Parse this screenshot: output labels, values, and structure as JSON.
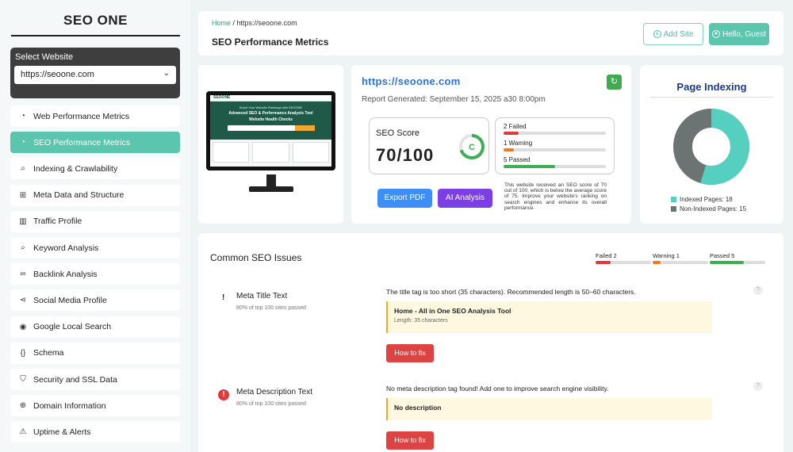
{
  "sidebar": {
    "brand": "SEO ONE",
    "select_label": "Select Website",
    "select_value": "https://seoone.com",
    "items": [
      {
        "label": "Web Performance Metrics",
        "icon": "gauge-icon",
        "glyph": "◔"
      },
      {
        "label": "SEO Performance Metrics",
        "icon": "gauge-icon",
        "glyph": "◔",
        "active": true
      },
      {
        "label": "Indexing & Crawlability",
        "icon": "search-icon",
        "glyph": "⌕"
      },
      {
        "label": "Meta Data and Structure",
        "icon": "sitemap-icon",
        "glyph": "⊞"
      },
      {
        "label": "Traffic Profile",
        "icon": "bar-chart-icon",
        "glyph": "▥"
      },
      {
        "label": "Keyword Analysis",
        "icon": "magnifier-icon",
        "glyph": "⌕"
      },
      {
        "label": "Backlink Analysis",
        "icon": "link-icon",
        "glyph": "∞"
      },
      {
        "label": "Social Media Profile",
        "icon": "share-icon",
        "glyph": "⋖"
      },
      {
        "label": "Google Local Search",
        "icon": "map-pin-icon",
        "glyph": "◉"
      },
      {
        "label": "Schema",
        "icon": "code-braces-icon",
        "glyph": "{}"
      },
      {
        "label": "Security and SSL Data",
        "icon": "shield-icon",
        "glyph": "⛉"
      },
      {
        "label": "Domain Information",
        "icon": "globe-icon",
        "glyph": "⊕"
      },
      {
        "label": "Uptime & Alerts",
        "icon": "warning-icon",
        "glyph": "⚠"
      }
    ]
  },
  "header": {
    "breadcrumb_home": "Home",
    "breadcrumb_sep": " / ",
    "breadcrumb_current": "https://seoone.com",
    "title": "SEO Performance Metrics",
    "add_site": "Add Site",
    "hello": "Hello, Guest"
  },
  "monitor": {
    "brand": "SEOONE",
    "tagline": "Boost Your Website Rankings with SEOONE",
    "hero_line1": "Advanced SEO & Performance Analysis Tool",
    "hero_line2": "Website Health Checks"
  },
  "score": {
    "url": "https://seoone.com",
    "report_generated": "Report Generated: September 15, 2025 a30 8:00pm",
    "label": "SEO Score",
    "value": "70/100",
    "grade": "C",
    "percent": 70,
    "failed_label": "2 Failed",
    "warning_label": "1 Warning",
    "passed_label": "5 Passed",
    "failed_frac": 0.15,
    "warning_frac": 0.1,
    "passed_frac": 0.5,
    "export_pdf": "Export PDF",
    "ai_analysis": "AI Analysis",
    "description": "This website received an SEO score of 70 out of 100, which is below the average score of 75. Improve your website's ranking on search engines and enhance its overall performance.",
    "colors": {
      "failed": "#e03a3a",
      "warning": "#f07b1f",
      "passed": "#3fae52",
      "ring": "#3fae52"
    }
  },
  "indexing": {
    "title": "Page Indexing",
    "indexed_label": "Indexed Pages: 18",
    "non_indexed_label": "Non-Indexed Pages: 15",
    "indexed": 18,
    "non_indexed": 15,
    "colors": {
      "indexed": "#55cfc0",
      "non_indexed": "#6b7473"
    }
  },
  "common": {
    "title": "Common SEO Issues",
    "failed": "Failed 2",
    "warning": "Warning 1",
    "passed": "Passed 5",
    "issues": [
      {
        "name": "Meta Title Text",
        "sub": "80% of top 100 sites passed",
        "msg": "The title tag is too short (35 characters). Recommended length is 50–60 characters.",
        "box_title": "Home - All in One SEO Analysis Tool",
        "box_sub": "Length: 35 characters",
        "fix": "How to fix",
        "help": "?"
      },
      {
        "name": "Meta Description Text",
        "sub": "80% of top 100 sites passed",
        "msg": "No meta description tag found! Add one to improve search engine visibility.",
        "box_title": "No description",
        "fix": "How to fix",
        "help": "?"
      }
    ]
  }
}
